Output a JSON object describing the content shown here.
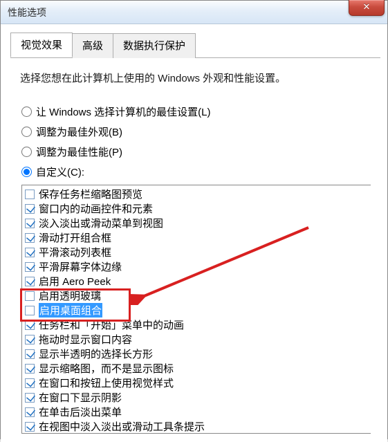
{
  "window": {
    "title": "性能选项",
    "close_label": "✕"
  },
  "tabs": [
    {
      "label": "视觉效果",
      "active": true
    },
    {
      "label": "高级",
      "active": false
    },
    {
      "label": "数据执行保护",
      "active": false
    }
  ],
  "description": "选择您想在此计算机上使用的 Windows 外观和性能设置。",
  "radios": [
    {
      "label": "让 Windows 选择计算机的最佳设置(L)",
      "checked": false
    },
    {
      "label": "调整为最佳外观(B)",
      "checked": false
    },
    {
      "label": "调整为最佳性能(P)",
      "checked": false
    },
    {
      "label": "自定义(C):",
      "checked": true
    }
  ],
  "checklist": [
    {
      "label": "保存任务栏缩略图预览",
      "checked": false
    },
    {
      "label": "窗口内的动画控件和元素",
      "checked": true
    },
    {
      "label": "淡入淡出或滑动菜单到视图",
      "checked": true
    },
    {
      "label": "滑动打开组合框",
      "checked": true
    },
    {
      "label": "平滑滚动列表框",
      "checked": true
    },
    {
      "label": "平滑屏幕字体边缘",
      "checked": true
    },
    {
      "label": "启用 Aero Peek",
      "checked": true
    },
    {
      "label": "启用透明玻璃",
      "checked": false
    },
    {
      "label": "启用桌面组合",
      "checked": false,
      "selected": true
    },
    {
      "label": "任务栏和「开始」菜单中的动画",
      "checked": true
    },
    {
      "label": "拖动时显示窗口内容",
      "checked": true
    },
    {
      "label": "显示半透明的选择长方形",
      "checked": true
    },
    {
      "label": "显示缩略图，而不是显示图标",
      "checked": true
    },
    {
      "label": "在窗口和按钮上使用视觉样式",
      "checked": true
    },
    {
      "label": "在窗口下显示阴影",
      "checked": true
    },
    {
      "label": "在单击后淡出菜单",
      "checked": true
    },
    {
      "label": "在视图中淡入淡出或滑动工具条提示",
      "checked": true
    }
  ],
  "annotation": {
    "highlighted_indices": [
      7,
      8
    ]
  }
}
